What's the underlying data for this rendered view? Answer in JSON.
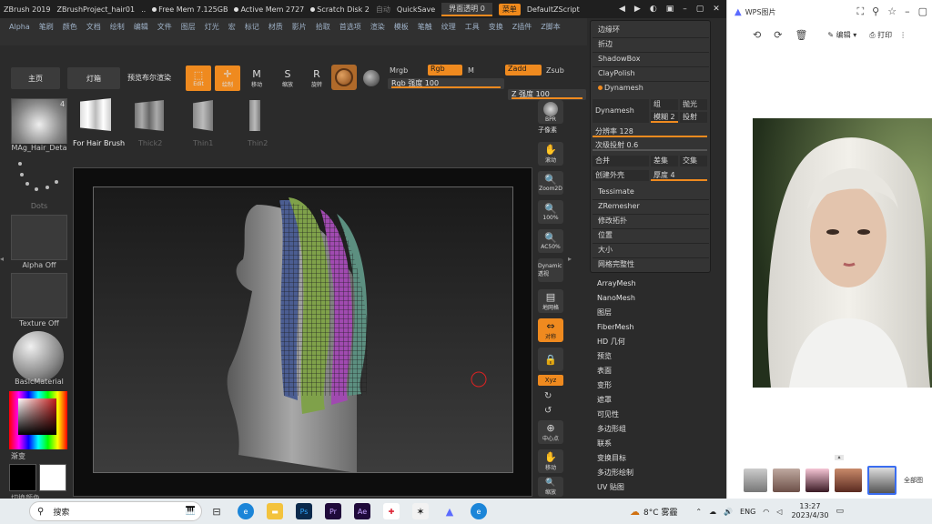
{
  "zbrush": {
    "title": {
      "app": "ZBrush 2019",
      "project": "ZBrushProject_hair01",
      "ellipsis": "..",
      "free_mem": "Free Mem 7.125GB",
      "active_mem": "Active Mem 2727",
      "scratch": "Scratch Disk 2",
      "auto": "自动",
      "quicksave": "QuickSave",
      "transparency": "界面透明 0",
      "menus": "菜单",
      "script": "DefaultZScript"
    },
    "menu_items": [
      "Alpha",
      "笔刷",
      "颜色",
      "文档",
      "绘制",
      "编辑",
      "文件",
      "图层",
      "灯光",
      "宏",
      "标记",
      "材质",
      "影片",
      "拾取",
      "首选项",
      "渲染",
      "模板",
      "笔触",
      "纹理",
      "工具",
      "变换",
      "Z插件",
      "Z脚本"
    ],
    "top": {
      "home": "主页",
      "lightbox": "灯箱",
      "bpr": "预览布尔渲染",
      "edit": "Edit",
      "draw": "绘制",
      "move": "移动",
      "scale": "缩放",
      "rotate": "旋转",
      "mrgb": "Mrgb",
      "rgb": "Rgb",
      "m": "M",
      "zadd": "Zadd",
      "zsub": "Zsub",
      "rgb_intensity": "Rgb 强度 100",
      "rgb_intensity_value": 100,
      "z_intensity": "Z 强度 100",
      "z_intensity_value": 100
    },
    "left": {
      "brush_name": "MAg_Hair_Deta",
      "brush_count": "4",
      "dots": "Dots",
      "alpha": "Alpha Off",
      "texture": "Texture Off",
      "material": "BasicMaterial",
      "gradient": "渐变",
      "switch_color": "切换颜色"
    },
    "brushes": [
      {
        "label": "For Hair Brush"
      },
      {
        "label": "Thick2"
      },
      {
        "label": "Thin1"
      },
      {
        "label": "Thin2"
      }
    ],
    "shelf": [
      {
        "icon": "bpr-icon",
        "label": "BPR"
      },
      {
        "icon": "subpixel-icon",
        "label": "子像素"
      },
      {
        "icon": "scroll-icon",
        "label": "滚动"
      },
      {
        "icon": "zoom2d-icon",
        "label": "Zoom2D"
      },
      {
        "icon": "zoom100-icon",
        "label": "100%"
      },
      {
        "icon": "ac50-icon",
        "label": "AC50%"
      },
      {
        "icon": "dynamic-icon",
        "label": "Dynamic 透视"
      },
      {
        "icon": "floor-icon",
        "label": "地网格"
      },
      {
        "icon": "frame-icon",
        "label": "对称"
      },
      {
        "icon": "lock-icon",
        "label": ""
      },
      {
        "icon": "xyz-icon",
        "label": "Xyz"
      },
      {
        "icon": "center-icon",
        "label": "中心点"
      },
      {
        "icon": "move-icon",
        "label": "移动"
      },
      {
        "icon": "scale-icon",
        "label": "缩放"
      }
    ],
    "palette": {
      "edge_loop": "边缘环",
      "fold": "折边",
      "shadowbox": "ShadowBox",
      "claypolish": "ClayPolish",
      "dynamesh_header": "Dynamesh",
      "dynamesh_btn": "Dynamesh",
      "group": "组",
      "polish": "抛光",
      "blur": "模糊 2",
      "project": "投射",
      "resolution": "分辨率 128",
      "resolution_value": 128,
      "sub_project": "次级投射 0.6",
      "sub_project_value": 0.6,
      "merge": "合并",
      "difference": "差集",
      "intersect": "交集",
      "create_shell": "创建外壳",
      "thickness": "厚度 4",
      "thickness_value": 4,
      "tessimate": "Tessimate",
      "zremesher": "ZRemesher",
      "modify_topo": "修改拓扑",
      "position": "位置",
      "size": "大小",
      "mesh_integrity": "网格完整性"
    },
    "sub_list": [
      "ArrayMesh",
      "NanoMesh",
      "图层",
      "FiberMesh",
      "HD 几何",
      "预览",
      "表面",
      "变形",
      "遮罩",
      "可见性",
      "多边形组",
      "联系",
      "变换目标",
      "多边形绘制",
      "UV 贴图"
    ]
  },
  "wps": {
    "title": "WPS图片",
    "edit": "编辑",
    "print": "打印",
    "all": "全部图"
  },
  "taskbar": {
    "search": "搜索",
    "weather": "8°C 雾霾",
    "lang": "ENG",
    "time": "13:27",
    "date": "2023/4/30",
    "app_labels": [
      "Ps",
      "Pr",
      "Ae"
    ]
  },
  "colors": {
    "accent": "#ef8a1f",
    "hair_green": "#7fa14a",
    "hair_blue": "#4b5d91",
    "hair_purple": "#a04ab0"
  }
}
